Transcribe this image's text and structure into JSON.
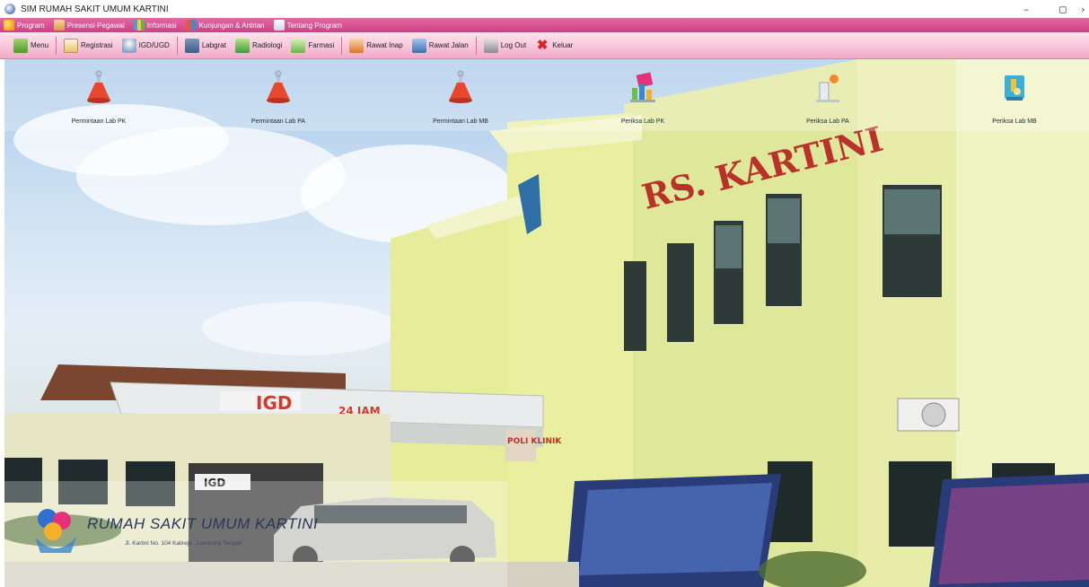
{
  "window": {
    "title": "SIM RUMAH SAKIT UMUM KARTINI",
    "controls": {
      "minimize": "–",
      "maximize": "◻",
      "more": "›"
    }
  },
  "menubar": {
    "items": [
      {
        "label": "Program",
        "icon": "key-icon"
      },
      {
        "label": "Presensi Pegawai",
        "icon": "person-icon"
      },
      {
        "label": "Informasi",
        "icon": "info-chart-icon"
      },
      {
        "label": "Kunjungan & Antrian",
        "icon": "people-icon"
      },
      {
        "label": "Tentang Program",
        "icon": "cup-icon"
      }
    ]
  },
  "toolbar": {
    "items": [
      {
        "label": "Menu",
        "icon": "home-icon"
      },
      {
        "label": "Registrasi",
        "icon": "registration-icon"
      },
      {
        "label": "IGD/UGD",
        "icon": "emergency-icon"
      },
      {
        "label": "Labgrat",
        "icon": "lab-icon"
      },
      {
        "label": "Radiologi",
        "icon": "radiology-icon"
      },
      {
        "label": "Farmasi",
        "icon": "pharmacy-icon"
      },
      {
        "label": "Rawat Inap",
        "icon": "inpatient-icon"
      },
      {
        "label": "Rawat Jalan",
        "icon": "outpatient-icon"
      },
      {
        "label": "Log Out",
        "icon": "logout-icon"
      },
      {
        "label": "Keluar",
        "icon": "exit-icon"
      }
    ]
  },
  "tiles": [
    {
      "label": "Permintaan Lab PK",
      "icon": "lab-flask-icon"
    },
    {
      "label": "Permintaan Lab PA",
      "icon": "lab-flask-icon"
    },
    {
      "label": "Permintaan Lab MB",
      "icon": "lab-flask-icon"
    },
    {
      "label": "Periksa Lab PK",
      "icon": "lab-equipment-icon"
    },
    {
      "label": "Periksa Lab PA",
      "icon": "lab-equipment-icon"
    },
    {
      "label": "Periksa Lab MB",
      "icon": "microscope-icon"
    }
  ],
  "background": {
    "building_sign": "RS. KARTINI",
    "igd_sign": "IGD",
    "igd_hours": "24 JAM",
    "poli_sign": "POLI KLINIK",
    "igd_door_sign": "IGD"
  },
  "hospital": {
    "name": "RUMAH SAKIT UMUM KARTINI",
    "address": "Jl. Kartini No. 104 Kalirejo , Lampung Tengah"
  },
  "colors": {
    "menubar": "#cf3f86",
    "toolbar": "#f7c3d9",
    "building": "#e6eea0"
  }
}
